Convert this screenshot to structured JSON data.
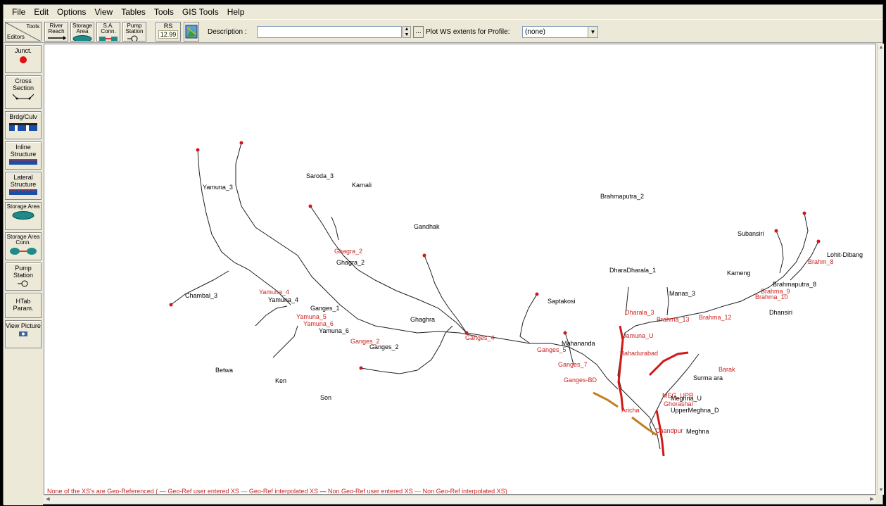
{
  "menu": [
    "File",
    "Edit",
    "Options",
    "View",
    "Tables",
    "Tools",
    "GIS Tools",
    "Help"
  ],
  "toolbar": {
    "tools_label": "Tools",
    "editors_label": "Editors",
    "river_reach": "River Reach",
    "storage_area": "Storage Area",
    "sa_conn": "S.A. Conn.",
    "pump_station": "Pump Station",
    "rs_label": "RS",
    "rs_value": "12.99",
    "description_label": "Description :",
    "description_value": "",
    "dots": "...",
    "plot_label": "Plot WS extents for Profile:",
    "plot_value": "(none)"
  },
  "left_tools": {
    "junct": "Junct.",
    "cross_section": "Cross Section",
    "brdg_culv": "Brdg/Culv",
    "inline_structure": "Inline Structure",
    "lateral_structure": "Lateral Structure",
    "storage_area": "Storage Area",
    "storage_area_conn": "Storage Area Conn.",
    "pump_station": "Pump Station",
    "htab_param": "HTab Param.",
    "view_picture": "View Picture"
  },
  "legend": {
    "prefix": "None of the XS's are Geo-Referenced ( ",
    "item1": "Geo-Ref user entered XS",
    "item2": "Geo-Ref interpolated XS",
    "item3": "Non Geo-Ref user entered XS",
    "item4": "Non Geo-Ref interpolated XS)",
    "colors": {
      "geo_user": "#1a7a1a",
      "geo_interp": "#30c030",
      "nongeo_user": "#202020",
      "nongeo_interp": "#d08020"
    }
  },
  "map_labels": {
    "saroda": "Saroda_3",
    "karnali": "Karnali",
    "brahmaputra2": "Brahmaputra_2",
    "gandhak": "Gandhak",
    "subansiri": "Subansiri",
    "lohit": "Lohit-Dibang",
    "brahm8": "Brahm_8",
    "ghagra2_red": "Ghagra_2",
    "ghagra2": "Ghagra_2",
    "dharala1": "DharaDharala_1",
    "kameng": "Kameng",
    "brahmaputra8": "Brahmaputra_8",
    "brahma9": "Brahma_9",
    "brahma10": "Brahma_10",
    "manas": "Manas_3",
    "dhansiri": "Dhansiri",
    "saptakosi": "Saptakosi",
    "yamuna3": "Yamuna_3",
    "chambal3": "Chambal_3",
    "yamuna4_red": "Yamuna_4",
    "yamuna4": "Yamuna_4",
    "ganges1": "Ganges_1",
    "yamuna5": "Yamuna_5",
    "yamuna6_red": "Yamuna_6",
    "yamuna6": "Yamuna_6",
    "ganges2_red": "Ganges_2",
    "ganges2": "Ganges_2",
    "ghaghra": "Ghaghra",
    "ganges4": "Ganges_4",
    "ganges5": "Ganges_5",
    "mahananda": "Mahananda",
    "ganges7": "Ganges_7",
    "gangesbd": "Ganges-BD",
    "dharala3": "Dharala_3",
    "brahma12": "Brahma_12",
    "brahma13": "Brahma_13",
    "jamunau": "Jamuna_U",
    "bahadurabad": "Bahadurabad",
    "barak": "Barak",
    "surma": "Surma ara",
    "meghnau": "Meghna_U",
    "megupr": "MEG_UPR",
    "ghorashal": "Ghorashal",
    "uppermeghna": "UpperMeghna_D",
    "aricha": "Aricha",
    "chandpur": "Chandpur",
    "meghna": "Meghna",
    "betwa": "Betwa",
    "ken": "Ken",
    "son": "Son"
  }
}
